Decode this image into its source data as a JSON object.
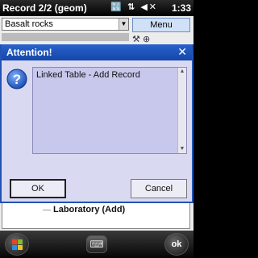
{
  "statusbar": {
    "title": "Record 2/2 (geom)",
    "icons": "🔣 ⇅ ◀✕",
    "time": "1:33"
  },
  "app": {
    "combo_value": "Basalt rocks",
    "menu_label": "Menu",
    "tree_item": "Laboratory (Add)"
  },
  "dialog": {
    "title": "Attention!",
    "close_glyph": "✕",
    "message": "Linked Table - Add Record",
    "ok_label": "OK",
    "cancel_label": "Cancel"
  },
  "softbar": {
    "keyboard_glyph": "⌨",
    "ok_label": "ok"
  },
  "colors": {
    "dialog_title": "#1447a8",
    "dialog_bg": "#d9d9f1",
    "message_bg": "#c8c8ec"
  }
}
